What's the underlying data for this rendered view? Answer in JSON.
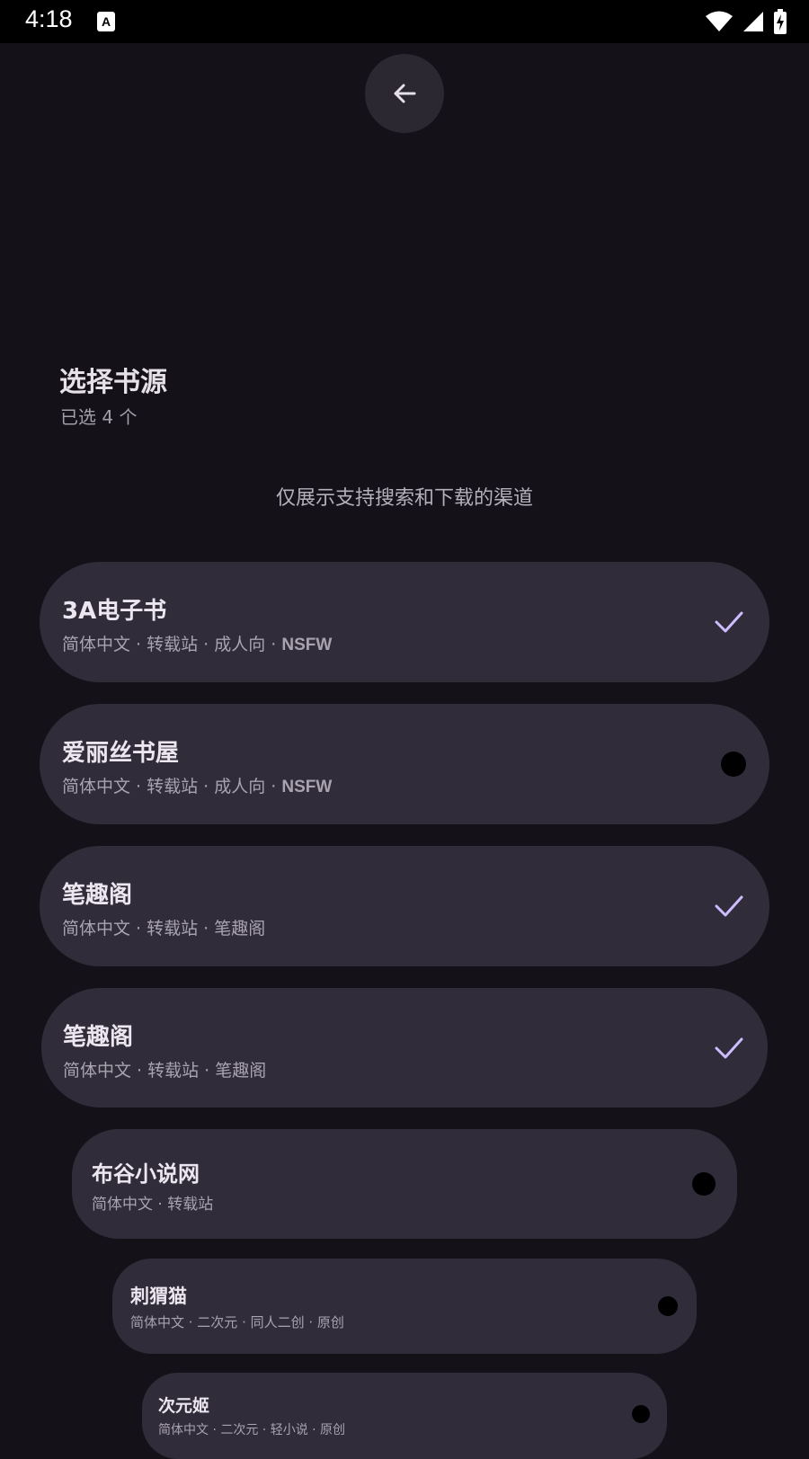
{
  "status_bar": {
    "time": "4:18",
    "notification_icon": "a-icon",
    "icons": [
      "wifi-icon",
      "signal-icon",
      "battery-charging-icon"
    ]
  },
  "header": {
    "back_icon": "arrow-left-icon",
    "title": "选择书源",
    "selected_count": "已选 4 个"
  },
  "hint": "仅展示支持搜索和下载的渠道",
  "colors": {
    "background": "#141218",
    "card": "#302c3a",
    "accent": "#cdbdff",
    "muted": "#a9a3b0"
  },
  "sources": [
    {
      "name": "3A电子书",
      "tags": "简体中文 · 转载站 · 成人向 · ",
      "tags_en": "NSFW",
      "selected": true
    },
    {
      "name": "爱丽丝书屋",
      "tags": "简体中文 · 转载站 · 成人向 · ",
      "tags_en": "NSFW",
      "selected": false
    },
    {
      "name": "笔趣阁",
      "tags": "简体中文 · 转载站 · 笔趣阁",
      "tags_en": "",
      "selected": true
    },
    {
      "name": "笔趣阁",
      "tags": "简体中文 · 转载站 · 笔趣阁",
      "tags_en": "",
      "selected": true
    },
    {
      "name": "布谷小说网",
      "tags": "简体中文 · 转载站",
      "tags_en": "",
      "selected": false
    },
    {
      "name": "刺猬猫",
      "tags": "简体中文 · 二次元 · 同人二创 · 原创",
      "tags_en": "",
      "selected": false
    },
    {
      "name": "次元姬",
      "tags": "简体中文 · 二次元 · 轻小说 · 原创",
      "tags_en": "",
      "selected": false
    }
  ]
}
